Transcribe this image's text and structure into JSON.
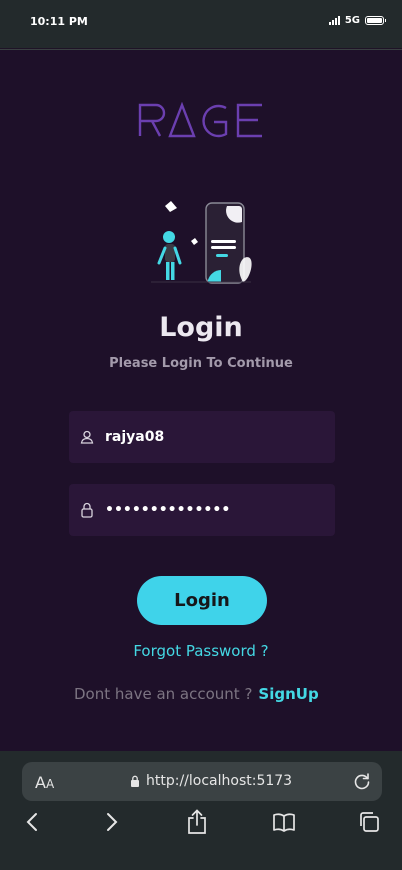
{
  "status_bar": {
    "time": "10:11 PM",
    "network": "5G"
  },
  "brand": {
    "logo_text": "RAGE"
  },
  "login": {
    "title": "Login",
    "subtitle": "Please Login To Continue",
    "username_value": "rajya08",
    "password_value": "••••••••••••••",
    "button_label": "Login",
    "forgot_label": "Forgot Password ?",
    "no_account_text": "Dont have an account ?",
    "signup_label": "SignUp"
  },
  "browser": {
    "text_size_label": "A",
    "text_size_small": "A",
    "url": "http://localhost:5173"
  },
  "colors": {
    "accent": "#3fd3ea",
    "brand_purple": "#6b3fb0",
    "background": "#1e1029"
  }
}
